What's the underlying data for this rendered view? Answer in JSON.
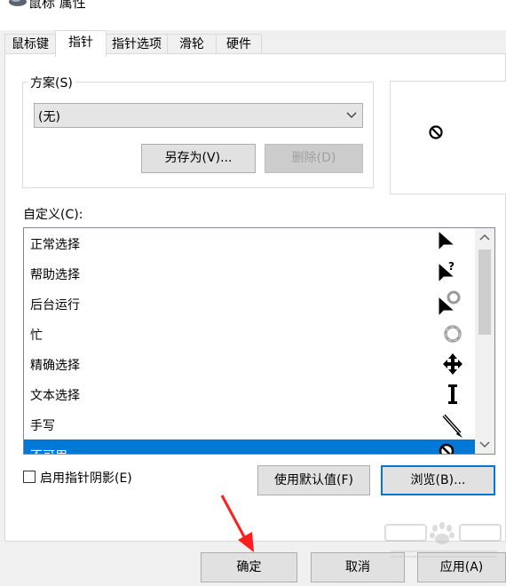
{
  "window": {
    "title": "鼠标 属性",
    "icon": "mouse-icon"
  },
  "tabs": [
    {
      "label": "鼠标键",
      "active": false
    },
    {
      "label": "指针",
      "active": true
    },
    {
      "label": "指针选项",
      "active": false
    },
    {
      "label": "滑轮",
      "active": false
    },
    {
      "label": "硬件",
      "active": false
    }
  ],
  "scheme": {
    "legend": "方案(S)",
    "selected": "(无)",
    "save_as_label": "另存为(V)...",
    "delete_label": "删除(D)"
  },
  "preview": {
    "icon": "unavailable-cursor-icon"
  },
  "customize": {
    "label": "自定义(C):",
    "items": [
      {
        "label": "正常选择",
        "icon": "arrow-cursor-icon",
        "selected": false
      },
      {
        "label": "帮助选择",
        "icon": "help-cursor-icon",
        "selected": false
      },
      {
        "label": "后台运行",
        "icon": "working-in-background-cursor-icon",
        "selected": false
      },
      {
        "label": "忙",
        "icon": "busy-cursor-icon",
        "selected": false
      },
      {
        "label": "精确选择",
        "icon": "precision-cursor-icon",
        "selected": false
      },
      {
        "label": "文本选择",
        "icon": "text-select-cursor-icon",
        "selected": false
      },
      {
        "label": "手写",
        "icon": "handwriting-cursor-icon",
        "selected": false
      },
      {
        "label": "不可用",
        "icon": "unavailable-cursor-icon",
        "selected": true
      }
    ]
  },
  "shadow": {
    "label": "启用指针阴影(E)",
    "checked": false
  },
  "buttons": {
    "use_default": "使用默认值(F)",
    "browse": "浏览(B)...",
    "ok": "确定",
    "cancel": "取消",
    "apply": "应用(A)"
  },
  "annotation": {
    "icon": "red-arrow-icon",
    "color": "#ff1e1e"
  },
  "watermark": {
    "icon": "baidu-jingyan-watermark-icon"
  },
  "colors": {
    "selection": "#0078d7",
    "focus": "#0078d7"
  }
}
